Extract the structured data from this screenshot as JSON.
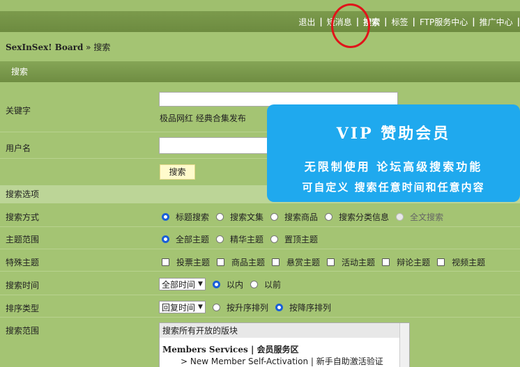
{
  "nav": {
    "links": [
      "退出",
      "短消息",
      "搜索",
      "标签",
      "FTP服务中心",
      "推广中心"
    ],
    "active": "搜索"
  },
  "breadcrumb": {
    "home": "SexInSex! Board",
    "sep": "»",
    "current": "搜索"
  },
  "search_header": "搜索",
  "keyword": {
    "label": "关键字",
    "value": "",
    "hint": "极品网红  经典合集发布"
  },
  "username": {
    "label": "用户名",
    "value": ""
  },
  "search_button": "搜索",
  "options_header": "搜索选项",
  "search_mode": {
    "label": "搜索方式",
    "options": [
      "标题搜索",
      "搜索文集",
      "搜索商品",
      "搜索分类信息",
      "全文搜索"
    ],
    "selected": "标题搜索",
    "disabled": [
      "全文搜索"
    ]
  },
  "topic_scope": {
    "label": "主题范围",
    "options": [
      "全部主题",
      "精华主题",
      "置顶主题"
    ],
    "selected": "全部主题"
  },
  "special_topics": {
    "label": "特殊主题",
    "options": [
      "投票主题",
      "商品主题",
      "悬赏主题",
      "活动主题",
      "辩论主题",
      "视频主题"
    ]
  },
  "search_time": {
    "label": "搜索时间",
    "select": "全部时间",
    "options": [
      "以内",
      "以前"
    ],
    "selected": "以内"
  },
  "sort_type": {
    "label": "排序类型",
    "select": "回复时间",
    "options": [
      "按升序排列",
      "按降序排列"
    ],
    "selected": "按降序排列"
  },
  "search_scope": {
    "label": "搜索范围",
    "box_header": "搜索所有开放的版块",
    "category_en": "Members Services",
    "category_cn": "会员服务区",
    "sub_item": "> New Member Self-Activation | 新手自助激活验证"
  },
  "vip": {
    "title": "VIP 赞助会员",
    "line1": "无限制使用 论坛高级搜索功能",
    "line2": "可自定义 搜索任意时间和任意内容"
  },
  "colors": {
    "accent_radio": "#1a5fd8",
    "banner": "#1fa9ee",
    "highlight": "#e0141a",
    "page_bg": "#a4c473"
  }
}
